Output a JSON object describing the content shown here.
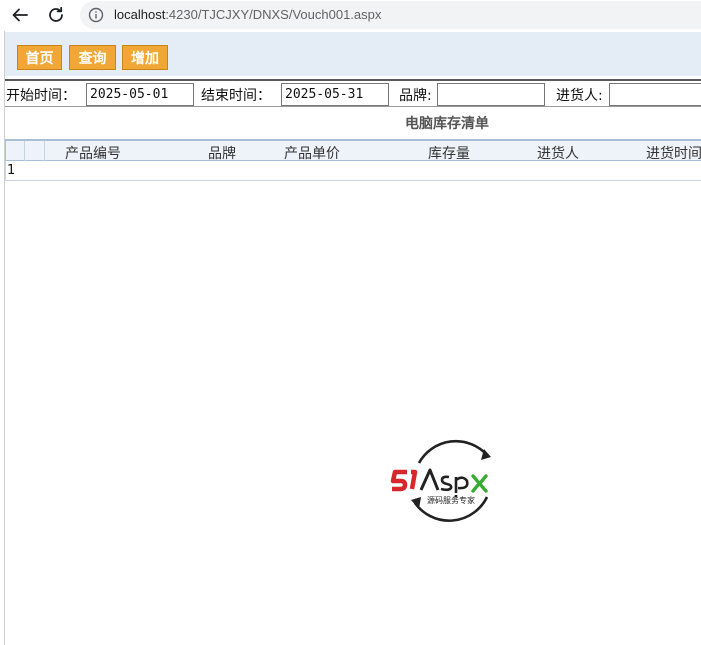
{
  "browser": {
    "url_host": "localhost",
    "url_rest": ":4230/TJCJXY/DNXS/Vouch001.aspx"
  },
  "toolbar": {
    "home_label": "首页",
    "query_label": "查询",
    "add_label": "增加"
  },
  "filters": {
    "start_label": "开始时间：",
    "start_value": "2025-05-01",
    "end_label": "结束时间：",
    "end_value": "2025-05-31",
    "brand_label": "品牌:",
    "brand_value": "",
    "buyer_label": "进货人:",
    "buyer_value": ""
  },
  "list": {
    "title": "电脑库存清单",
    "columns": [
      "产品编号",
      "品牌",
      "产品单价",
      "库存量",
      "进货人",
      "进货时间"
    ],
    "rows": [
      {
        "index": "1"
      }
    ]
  },
  "watermark": {
    "logo_text": "51Aspx",
    "tagline": "源码服务专家",
    "colors": {
      "red": "#d7262c",
      "dark": "#222222",
      "green": "#3aaa35"
    }
  }
}
